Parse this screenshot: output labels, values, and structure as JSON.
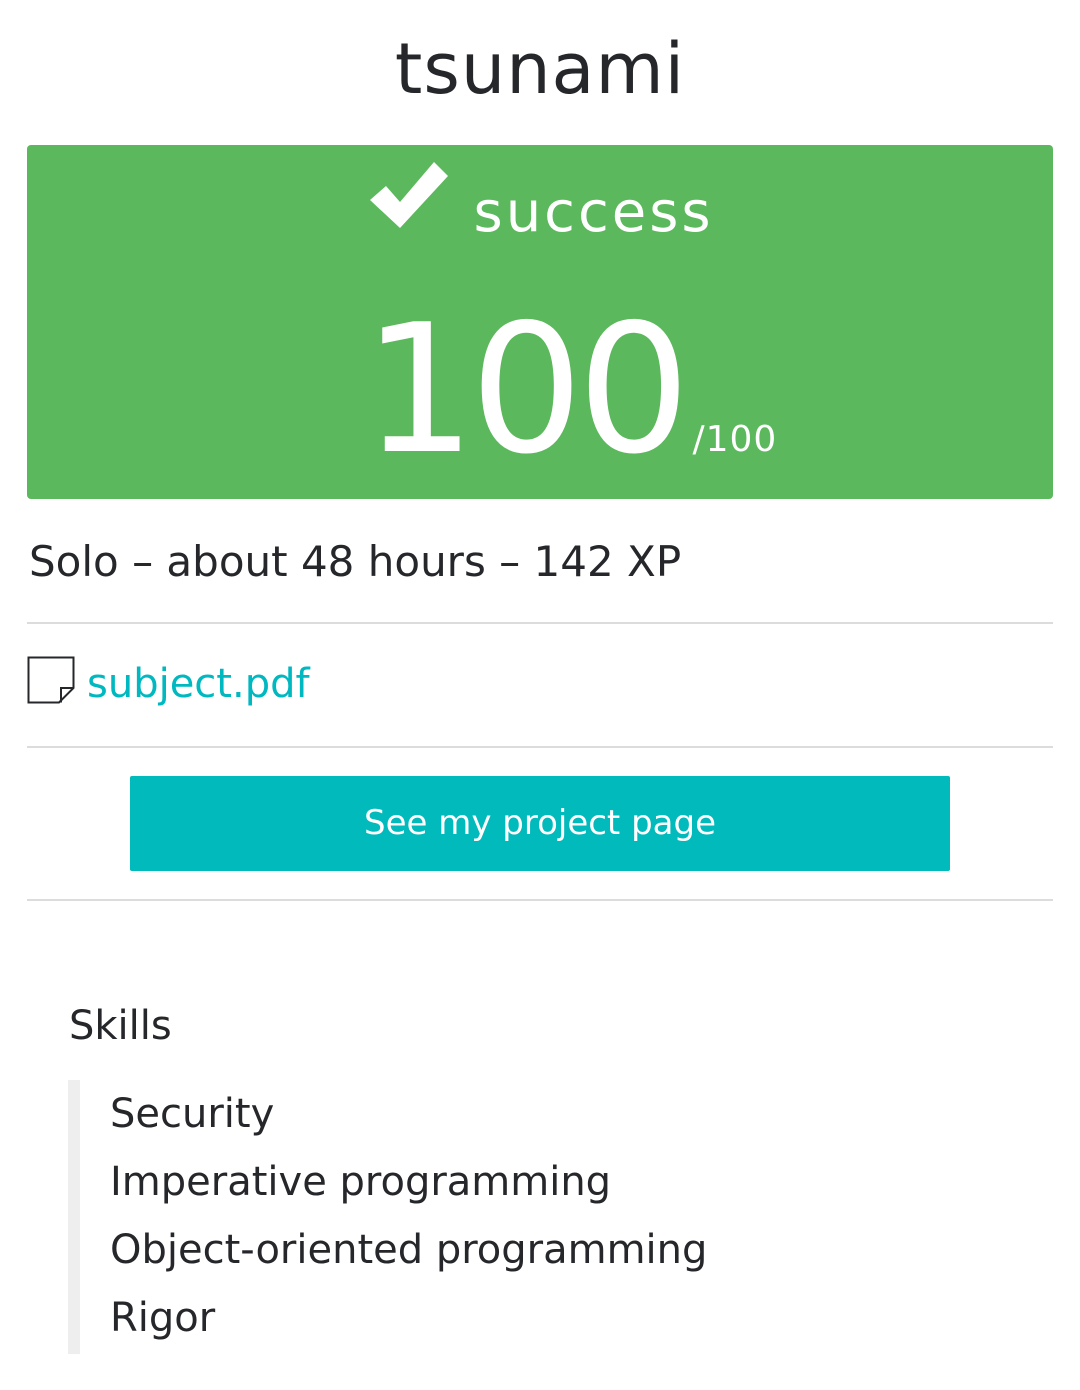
{
  "project": {
    "title": "tsunami"
  },
  "result": {
    "status": "success",
    "grade": "100",
    "grade_max": "/100",
    "color": "#5cb85c",
    "icon": "check-icon"
  },
  "meta": {
    "text": "Solo – about 48 hours – 142 XP"
  },
  "subject": {
    "icon": "file-icon",
    "label": "subject.pdf",
    "color": "#00b8c0"
  },
  "actions": {
    "project_page_label": "See my project page",
    "button_color": "#00babc"
  },
  "skills": {
    "heading": "Skills",
    "items": [
      "Security",
      "Imperative programming",
      "Object-oriented programming",
      "Rigor"
    ]
  }
}
